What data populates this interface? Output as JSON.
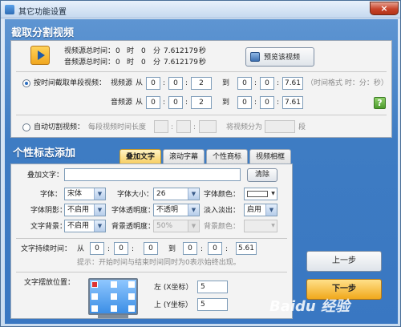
{
  "window": {
    "title": "其它功能设置",
    "close_label": "×"
  },
  "clip": {
    "section_title": "截取分割视频",
    "video_total_label": "视频源总时间：",
    "audio_total_label": "音频源总时间：",
    "video_total": {
      "h": "0",
      "h_unit": "时",
      "m": "0",
      "m_unit": "分",
      "s": "7.612179",
      "s_unit": "秒"
    },
    "audio_total": {
      "h": "0",
      "h_unit": "时",
      "m": "0",
      "m_unit": "分",
      "s": "7.612179",
      "s_unit": "秒"
    },
    "preview_button": "预览该视频",
    "mode_by_time": "按时间截取单段视频：",
    "video_source": "视频源",
    "audio_source": "音频源",
    "from": "从",
    "to": "到",
    "colon": ":",
    "video_from": [
      "0",
      "0",
      "2"
    ],
    "video_to": [
      "0",
      "0",
      "7.61"
    ],
    "audio_from": [
      "0",
      "0",
      "2"
    ],
    "audio_to": [
      "0",
      "0",
      "7.61"
    ],
    "time_format_hint": "（时间格式 时：分：秒）",
    "help": "?",
    "mode_auto": "自动切割视频：",
    "segment_len_label": "每段视频时间长度",
    "split_into_label": "将视频分为",
    "segment_unit": "段"
  },
  "personal": {
    "section_title": "个性标志添加",
    "tabs": [
      "叠加文字",
      "滚动字幕",
      "个性商标",
      "视频相框"
    ],
    "overlay_text_label": "叠加文字：",
    "overlay_text_value": "",
    "clear_button": "清除",
    "font_label": "字体：",
    "font_value": "宋体",
    "font_size_label": "字体大小：",
    "font_size_value": "26",
    "font_color_label": "字体颜色：",
    "shadow_label": "字体阴影：",
    "shadow_value": "不启用",
    "font_opacity_label": "字体透明度：",
    "font_opacity_value": "不透明",
    "fade_label": "淡入淡出：",
    "fade_value": "启用",
    "bg_label": "文字背景：",
    "bg_value": "不启用",
    "bg_opacity_label": "背景透明度：",
    "bg_opacity_value": "50%",
    "bg_color_label": "背景颜色：",
    "duration_label": "文字持续时间：",
    "duration_from": "从",
    "duration_to": "到",
    "duration_start": [
      "0",
      "0",
      "0"
    ],
    "duration_end": [
      "0",
      "0",
      "5.61"
    ],
    "duration_hint": "提示：开始时间与结束时间同时为0表示始终出现。",
    "position_label": "文字摆放位置：",
    "left_label": "左 (X坐标）",
    "left_value": "5",
    "top_label": "上 (Y坐标）",
    "top_value": "5"
  },
  "buttons": {
    "prev": "上一步",
    "next": "下一步"
  },
  "watermark": "Baidu 经验",
  "colors": {
    "section_bg": "#3f7cc3",
    "active_tab": "#f7cf63",
    "next_button": "#f0a81c",
    "help_icon": "#5aa83a"
  }
}
